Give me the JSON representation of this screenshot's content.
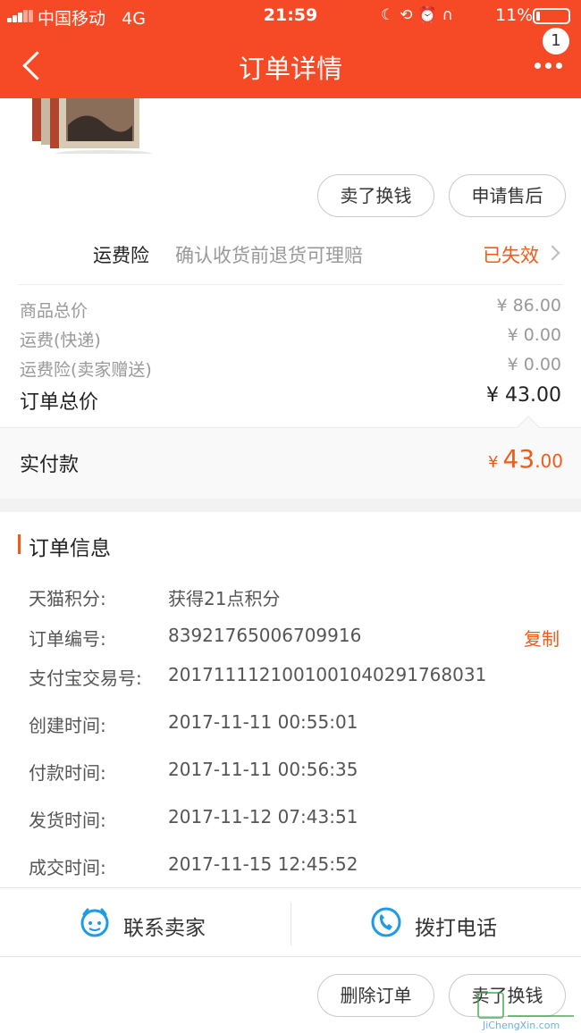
{
  "status_bar": {
    "carrier": "中国移动",
    "network": "4G",
    "time": "21:59",
    "battery": "11%",
    "icons": [
      "moon-icon",
      "rotation-lock-icon",
      "alarm-icon",
      "headphones-icon"
    ]
  },
  "nav": {
    "title": "订单详情",
    "badge": "1",
    "accent": "#f64a27"
  },
  "actions_top": {
    "sell_label": "卖了换钱",
    "after_sale_label": "申请售后"
  },
  "shipping_insurance": {
    "label": "运费险",
    "description": "确认收货前退货可理赔",
    "status": "已失效"
  },
  "price_rows": [
    {
      "label": "商品总价",
      "value": "¥ 86.00"
    },
    {
      "label": "运费(快递)",
      "value": "¥ 0.00"
    },
    {
      "label": "运费险(卖家赠送)",
      "value": "¥ 0.00"
    }
  ],
  "order_total": {
    "label": "订单总价",
    "value": "¥ 43.00"
  },
  "paid": {
    "label": "实付款",
    "currency": "¥",
    "integer": "43",
    "decimal": ".00",
    "color": "#f25a17"
  },
  "order_info": {
    "title": "订单信息",
    "copy_label": "复制",
    "rows": [
      {
        "label": "天猫积分:",
        "value": "获得21点积分"
      },
      {
        "label": "订单编号:",
        "value": "83921765006709916"
      },
      {
        "label": "支付宝交易号:",
        "value": "2017111121001001040291768031"
      },
      {
        "label": "创建时间:",
        "value": "2017-11-11 00:55:01"
      },
      {
        "label": "付款时间:",
        "value": "2017-11-11 00:56:35"
      },
      {
        "label": "发货时间:",
        "value": "2017-11-12 07:43:51"
      },
      {
        "label": "成交时间:",
        "value": "2017-11-15 12:45:52"
      }
    ]
  },
  "contact": {
    "seller_label": "联系卖家",
    "phone_label": "拨打电话",
    "icon_color": "#1e9be6"
  },
  "actions_bottom": {
    "delete_label": "删除订单",
    "sell_label": "卖了换钱"
  },
  "watermark": {
    "text": "JiChengXin.com"
  }
}
